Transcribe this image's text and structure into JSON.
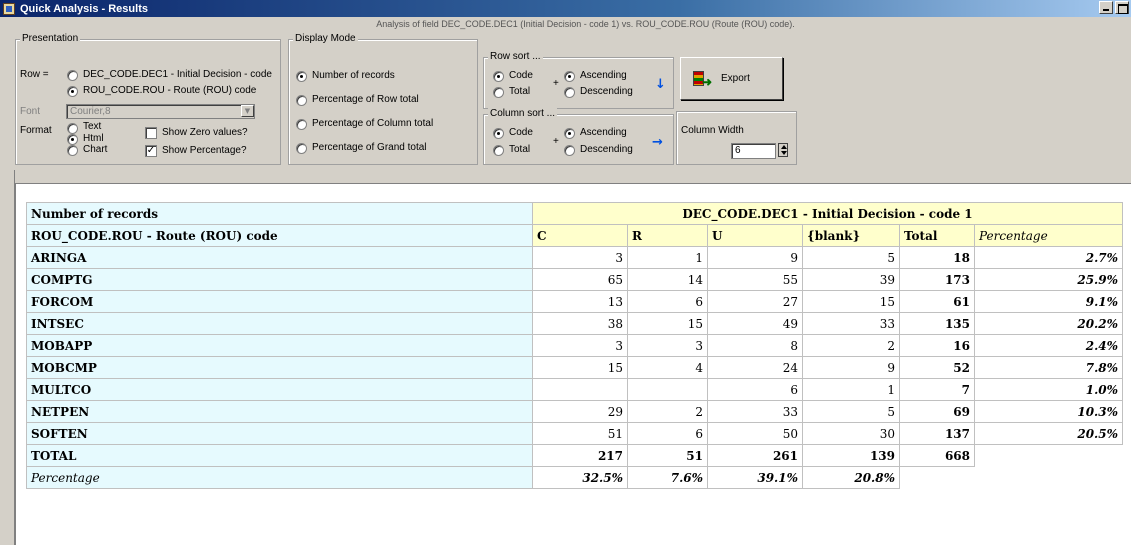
{
  "window": {
    "title": "Quick Analysis - Results",
    "subtitle": "Analysis of field DEC_CODE.DEC1 (Initial Decision - code 1) vs. ROU_CODE.ROU (Route (ROU) code)."
  },
  "presentation": {
    "group_label": "Presentation",
    "row_label": "Row =",
    "row_option_1": "DEC_CODE.DEC1 - Initial Decision - code",
    "row_option_2": "ROU_CODE.ROU - Route (ROU) code",
    "font_label": "Font",
    "font_value": "Courier,8",
    "format_label": "Format",
    "format_text": "Text",
    "format_html": "Html",
    "format_chart": "Chart",
    "show_zero": "Show Zero values?",
    "show_percentage": "Show Percentage?"
  },
  "display_mode": {
    "group_label": "Display Mode",
    "options": [
      "Number of records",
      "Percentage of Row total",
      "Percentage of Column total",
      "Percentage of Grand total"
    ],
    "selected_index": 0
  },
  "row_sort": {
    "group_label": "Row sort ...",
    "code": "Code",
    "total": "Total",
    "ascending": "Ascending",
    "descending": "Descending"
  },
  "column_sort": {
    "group_label": "Column sort ...",
    "code": "Code",
    "total": "Total",
    "ascending": "Ascending",
    "descending": "Descending"
  },
  "export_button": "Export",
  "column_width": {
    "label": "Column Width",
    "value": "6"
  },
  "table": {
    "corner_label": "Number of records",
    "column_field": "DEC_CODE.DEC1 - Initial Decision - code 1",
    "row_field": "ROU_CODE.ROU - Route (ROU) code",
    "columns": [
      "C",
      "R",
      "U",
      "{blank}",
      "Total",
      "Percentage"
    ],
    "rows": [
      {
        "name": "ARINGA",
        "c": "3",
        "r": "1",
        "u": "9",
        "blank": "5",
        "total": "18",
        "pct": "2.7%"
      },
      {
        "name": "COMPTG",
        "c": "65",
        "r": "14",
        "u": "55",
        "blank": "39",
        "total": "173",
        "pct": "25.9%"
      },
      {
        "name": "FORCOM",
        "c": "13",
        "r": "6",
        "u": "27",
        "blank": "15",
        "total": "61",
        "pct": "9.1%"
      },
      {
        "name": "INTSEC",
        "c": "38",
        "r": "15",
        "u": "49",
        "blank": "33",
        "total": "135",
        "pct": "20.2%"
      },
      {
        "name": "MOBAPP",
        "c": "3",
        "r": "3",
        "u": "8",
        "blank": "2",
        "total": "16",
        "pct": "2.4%"
      },
      {
        "name": "MOBCMP",
        "c": "15",
        "r": "4",
        "u": "24",
        "blank": "9",
        "total": "52",
        "pct": "7.8%"
      },
      {
        "name": "MULTCO",
        "c": "",
        "r": "",
        "u": "6",
        "blank": "1",
        "total": "7",
        "pct": "1.0%"
      },
      {
        "name": "NETPEN",
        "c": "29",
        "r": "2",
        "u": "33",
        "blank": "5",
        "total": "69",
        "pct": "10.3%"
      },
      {
        "name": "SOFTEN",
        "c": "51",
        "r": "6",
        "u": "50",
        "blank": "30",
        "total": "137",
        "pct": "20.5%"
      }
    ],
    "total_row": {
      "name": "TOTAL",
      "c": "217",
      "r": "51",
      "u": "261",
      "blank": "139",
      "total": "668"
    },
    "pct_row": {
      "name": "Percentage",
      "c": "32.5%",
      "r": "7.6%",
      "u": "39.1%",
      "blank": "20.8%"
    }
  },
  "colors": {
    "row_header_bg": "#e6fafe",
    "col_header_bg": "#ffffcc",
    "arrow": "#0050e0"
  }
}
